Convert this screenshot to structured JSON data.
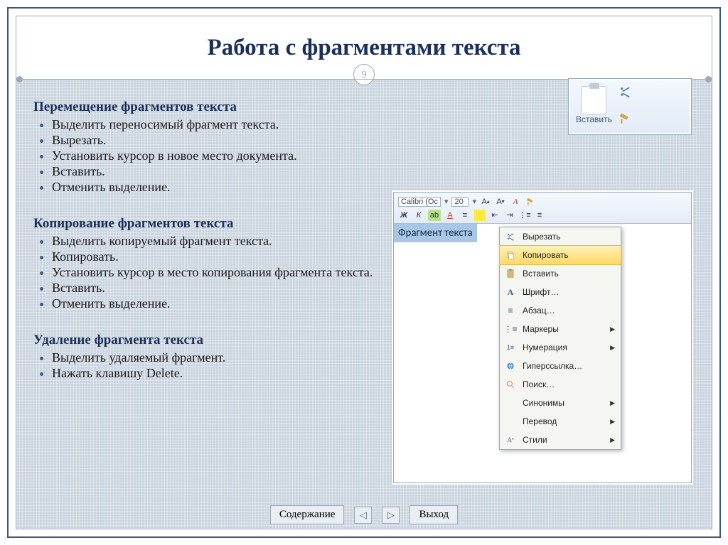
{
  "title": "Работа с фрагментами текста",
  "page_number": "9",
  "section1": {
    "heading": "Перемещение фрагментов текста",
    "items": [
      "Выделить переносимый фрагмент текста.",
      "Вырезать.",
      "Установить курсор в новое место документа.",
      "Вставить.",
      "Отменить выделение."
    ]
  },
  "section2": {
    "heading": "Копирование фрагментов текста",
    "items": [
      "Выделить копируемый фрагмент текста.",
      "Копировать.",
      "Установить курсор в место копирования фрагмента текста.",
      "Вставить.",
      "Отменить выделение."
    ]
  },
  "section3": {
    "heading": "Удаление фрагмента текста",
    "items": [
      "Выделить удаляемый фрагмент.",
      "Нажать клавишу Delete."
    ]
  },
  "clipboard_panel": {
    "paste_label": "Вставить"
  },
  "word_panel": {
    "font_name": "Calibri (Ос",
    "font_size": "20",
    "selected_text": "Фрагмент текста"
  },
  "context_menu": {
    "cut": "Вырезать",
    "copy": "Копировать",
    "paste": "Вставить",
    "font": "Шрифт…",
    "paragraph": "Абзац…",
    "bullets": "Маркеры",
    "numbering": "Нумерация",
    "hyperlink": "Гиперссылка…",
    "find": "Поиск…",
    "synonyms": "Синонимы",
    "translate": "Перевод",
    "styles": "Стили"
  },
  "footer": {
    "contents": "Содержание",
    "exit": "Выход"
  }
}
